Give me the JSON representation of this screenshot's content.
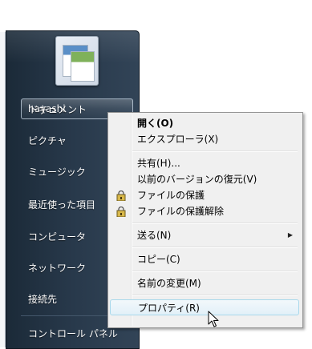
{
  "start_menu": {
    "user_name": "hayashi",
    "items": [
      {
        "label": "ドキュメント",
        "selected": true
      },
      {
        "label": "ピクチャ"
      },
      {
        "label": "ミュージック"
      },
      {
        "label": "最近使った項目"
      },
      {
        "label": "コンピュータ"
      },
      {
        "label": "ネットワーク"
      },
      {
        "label": "接続先"
      },
      {
        "label": "コントロール パネル"
      }
    ]
  },
  "context_menu": {
    "items": [
      {
        "label": "開く(O)",
        "bold": true
      },
      {
        "label": "エクスプローラ(X)"
      },
      {
        "label": "共有(H)..."
      },
      {
        "label": "以前のバージョンの復元(V)"
      },
      {
        "label": "ファイルの保護",
        "icon": "lock-icon"
      },
      {
        "label": "ファイルの保護解除",
        "icon": "unlock-icon"
      },
      {
        "label": "送る(N)",
        "submenu": true
      },
      {
        "label": "コピー(C)"
      },
      {
        "label": "名前の変更(M)"
      },
      {
        "label": "プロパティ(R)",
        "hover": true
      }
    ],
    "submenu_arrow": "▶"
  },
  "colors": {
    "panel_dark": "#1b2a38",
    "menu_bg": "#f0f0f0",
    "hover_border": "#a8d8eb"
  }
}
